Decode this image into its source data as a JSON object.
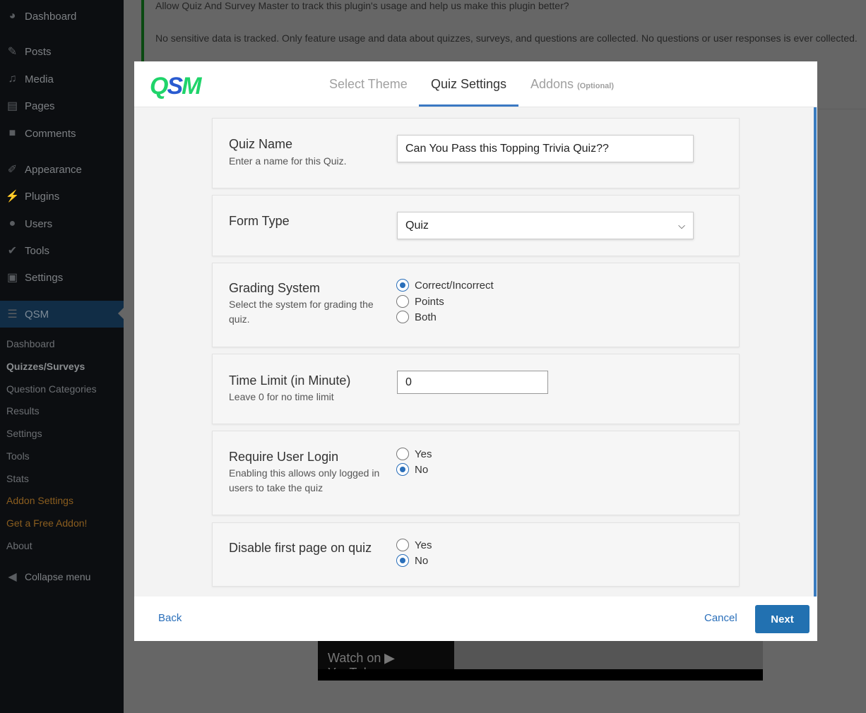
{
  "sidebar": {
    "menu": [
      {
        "label": "Dashboard",
        "icon": "dashboard-icon"
      },
      {
        "label": "Posts",
        "icon": "pin-icon"
      },
      {
        "label": "Media",
        "icon": "media-icon"
      },
      {
        "label": "Pages",
        "icon": "pages-icon"
      },
      {
        "label": "Comments",
        "icon": "comment-icon"
      },
      {
        "label": "Appearance",
        "icon": "brush-icon"
      },
      {
        "label": "Plugins",
        "icon": "plugin-icon"
      },
      {
        "label": "Users",
        "icon": "user-icon"
      },
      {
        "label": "Tools",
        "icon": "wrench-icon"
      },
      {
        "label": "Settings",
        "icon": "settings-icon"
      },
      {
        "label": "QSM",
        "icon": "qsm-icon"
      }
    ],
    "submenu": [
      "Dashboard",
      "Quizzes/Surveys",
      "Question Categories",
      "Results",
      "Settings",
      "Tools",
      "Stats",
      "Addon Settings",
      "Get a Free Addon!",
      "About"
    ],
    "collapse": "Collapse menu"
  },
  "notice": {
    "line1": "Allow Quiz And Survey Master to track this plugin's usage and help us make this plugin better?",
    "line2": "No sensitive data is tracked. Only feature usage and data about quizzes, surveys, and questions are collected. No questions or user responses is ever collected."
  },
  "video": {
    "watch": "Watch on",
    "brand": "YouTube"
  },
  "modal": {
    "logo": "QSM",
    "tabs": [
      {
        "label": "Select Theme"
      },
      {
        "label": "Quiz Settings",
        "active": true
      },
      {
        "label": "Addons",
        "note": "(Optional)"
      }
    ],
    "fields": {
      "quiz_name": {
        "label": "Quiz Name",
        "desc": "Enter a name for this Quiz.",
        "value": "Can You Pass this Topping Trivia Quiz??"
      },
      "form_type": {
        "label": "Form Type",
        "value": "Quiz"
      },
      "grading": {
        "label": "Grading System",
        "desc": "Select the system for grading the quiz.",
        "options": [
          "Correct/Incorrect",
          "Points",
          "Both"
        ],
        "selected": "Correct/Incorrect"
      },
      "time_limit": {
        "label": "Time Limit (in Minute)",
        "desc": "Leave 0 for no time limit",
        "value": "0"
      },
      "login": {
        "label": "Require User Login",
        "desc": "Enabling this allows only logged in users to take the quiz",
        "options": [
          "Yes",
          "No"
        ],
        "selected": "No"
      },
      "first_page": {
        "label": "Disable first page on quiz",
        "options": [
          "Yes",
          "No"
        ],
        "selected": "No"
      }
    },
    "footer": {
      "back": "Back",
      "cancel": "Cancel",
      "next": "Next"
    },
    "accent": "#2271b1"
  }
}
